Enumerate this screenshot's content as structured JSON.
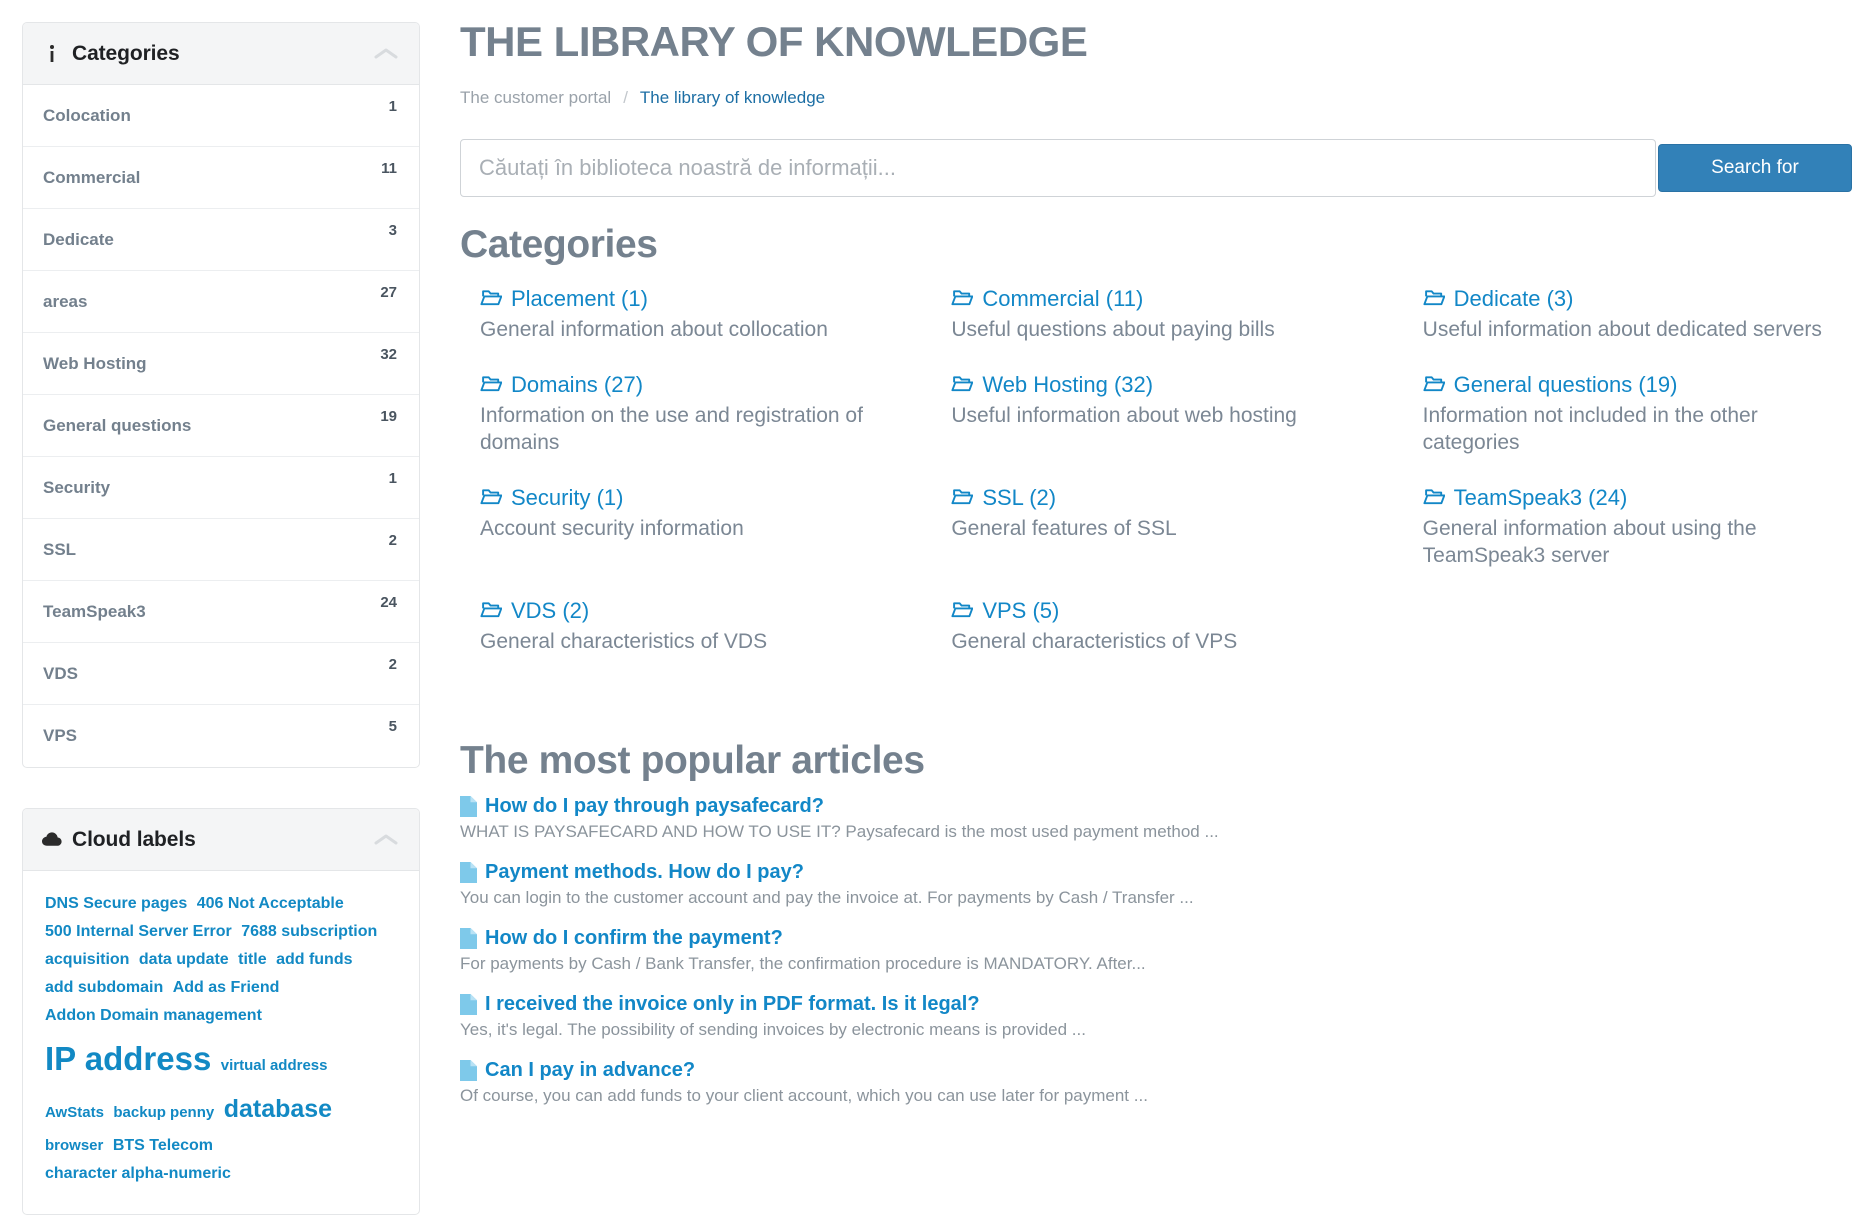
{
  "sidebar": {
    "categories_panel": {
      "icon": "info-icon",
      "title": "Categories",
      "collapse_icon": "chevron-up-icon",
      "items": [
        {
          "label": "Colocation",
          "count": "1"
        },
        {
          "label": "Commercial",
          "count": "11"
        },
        {
          "label": "Dedicate",
          "count": "3"
        },
        {
          "label": "areas",
          "count": "27"
        },
        {
          "label": "Web Hosting",
          "count": "32"
        },
        {
          "label": "General questions",
          "count": "19"
        },
        {
          "label": "Security",
          "count": "1"
        },
        {
          "label": "SSL",
          "count": "2"
        },
        {
          "label": "TeamSpeak3",
          "count": "24"
        },
        {
          "label": "VDS",
          "count": "2"
        },
        {
          "label": "VPS",
          "count": "5"
        }
      ]
    },
    "cloud_panel": {
      "icon": "cloud-icon",
      "title": "Cloud labels",
      "collapse_icon": "chevron-up-icon",
      "tags": [
        {
          "label": "DNS Secure pages",
          "size": "s1"
        },
        {
          "label": "406 Not Acceptable",
          "size": "s1"
        },
        {
          "label": "500 Internal Server Error",
          "size": "s1"
        },
        {
          "label": "7688 subscription",
          "size": "s1"
        },
        {
          "label": "acquisition",
          "size": "s1"
        },
        {
          "label": "data update",
          "size": "s1"
        },
        {
          "label": "title",
          "size": "s1"
        },
        {
          "label": "add funds",
          "size": "s1"
        },
        {
          "label": "add subdomain",
          "size": "s1"
        },
        {
          "label": "Add as Friend",
          "size": "s1"
        },
        {
          "label": "Addon Domain management",
          "size": "s1"
        },
        {
          "label": "IP address",
          "size": "s5"
        },
        {
          "label": "virtual address",
          "size": "s2"
        },
        {
          "label": "AwStats",
          "size": "s2"
        },
        {
          "label": "backup penny",
          "size": "s2"
        },
        {
          "label": "database",
          "size": "s4"
        },
        {
          "label": "browser",
          "size": "s2"
        },
        {
          "label": "BTS Telecom",
          "size": "s1"
        },
        {
          "label": "character alpha-numeric",
          "size": "s1"
        }
      ]
    }
  },
  "header": {
    "title": "THE LIBRARY OF KNOWLEDGE",
    "breadcrumb": {
      "root": "The customer portal",
      "separator": "/",
      "current": "The library of knowledge"
    }
  },
  "search": {
    "placeholder": "Căutați în biblioteca noastră de informații...",
    "value": "",
    "button_label": "Search for"
  },
  "categories_section": {
    "heading": "Categories",
    "items": [
      {
        "title": "Placement (1)",
        "desc": "General information about collocation"
      },
      {
        "title": "Commercial (11)",
        "desc": "Useful questions about paying bills"
      },
      {
        "title": "Dedicate (3)",
        "desc": "Useful information about dedicated servers"
      },
      {
        "title": "Domains (27)",
        "desc": "Information on the use and registration of domains"
      },
      {
        "title": "Web Hosting (32)",
        "desc": "Useful information about web hosting"
      },
      {
        "title": "General questions (19)",
        "desc": "Information not included in the other categories"
      },
      {
        "title": "Security (1)",
        "desc": "Account security information"
      },
      {
        "title": "SSL (2)",
        "desc": "General features of SSL"
      },
      {
        "title": "TeamSpeak3 (24)",
        "desc": "General information about using the TeamSpeak3 server"
      },
      {
        "title": "VDS (2)",
        "desc": "General characteristics of VDS"
      },
      {
        "title": "VPS (5)",
        "desc": "General characteristics of VPS"
      }
    ]
  },
  "articles_section": {
    "heading": "The most popular articles",
    "items": [
      {
        "title": "How do I pay through paysafecard?",
        "excerpt": "WHAT IS PAYSAFECARD AND HOW TO USE IT? Paysafecard is the most used payment method ..."
      },
      {
        "title": "Payment methods. How do I pay?",
        "excerpt": "You can login to the customer account and pay the invoice at. For payments by Cash / Transfer ..."
      },
      {
        "title": "How do I confirm the payment?",
        "excerpt": "For payments by Cash / Bank Transfer, the confirmation procedure is MANDATORY. After..."
      },
      {
        "title": "I received the invoice only in PDF format. Is it legal?",
        "excerpt": "Yes, it's legal. The possibility of sending invoices by electronic means is provided ..."
      },
      {
        "title": "Can I pay in advance?",
        "excerpt": "Of course, you can add funds to your client account, which you can use later for payment ..."
      }
    ]
  },
  "colors": {
    "link": "#1287c7",
    "heading": "#74818e",
    "button": "#3281b8",
    "tag": "#1289c4"
  }
}
